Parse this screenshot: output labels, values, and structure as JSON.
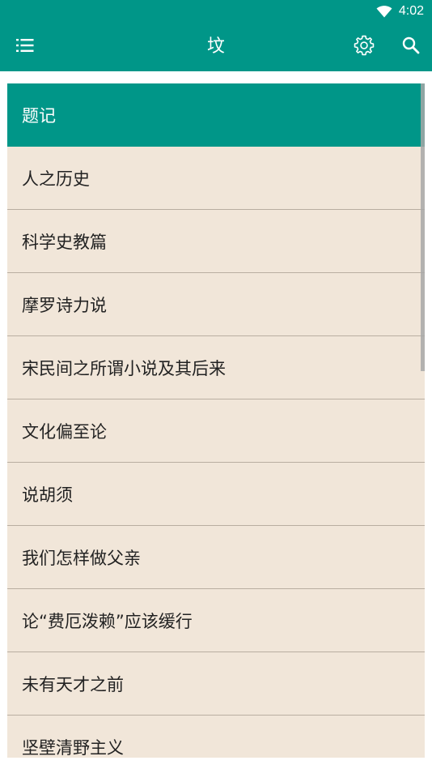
{
  "status_bar": {
    "time": "4:02",
    "icons": [
      "wifi-icon"
    ]
  },
  "app_bar": {
    "title": "坟",
    "left_icon": "menu-list-icon",
    "right_icons": [
      "settings-gear-icon",
      "search-icon"
    ]
  },
  "colors": {
    "primary": "#009688",
    "list_background": "#f1e6d9",
    "divider": "#b9aea1",
    "text": "#222222"
  },
  "chapters": [
    {
      "title": "题记",
      "active": true
    },
    {
      "title": "人之历史",
      "active": false
    },
    {
      "title": "科学史教篇",
      "active": false
    },
    {
      "title": "摩罗诗力说",
      "active": false
    },
    {
      "title": "宋民间之所谓小说及其后来",
      "active": false
    },
    {
      "title": "文化偏至论",
      "active": false
    },
    {
      "title": "说胡须",
      "active": false
    },
    {
      "title": "我们怎样做父亲",
      "active": false
    },
    {
      "title": "论“费厄泼赖”应该缓行",
      "active": false
    },
    {
      "title": "未有天才之前",
      "active": false
    },
    {
      "title": "坚壁清野主义",
      "active": false
    }
  ]
}
